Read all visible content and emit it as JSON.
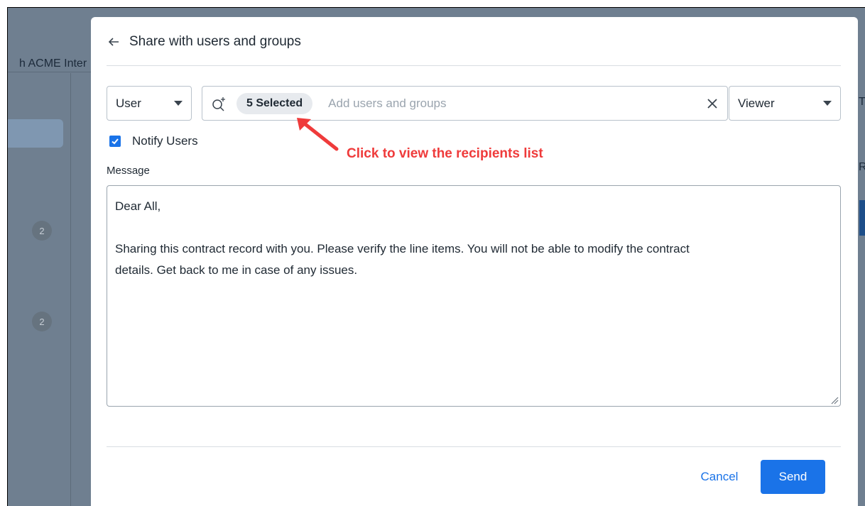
{
  "background": {
    "header_text": "h  ACME Inter",
    "badges": [
      "2",
      "2"
    ],
    "right_letters": [
      "T",
      "R"
    ]
  },
  "modal": {
    "back_icon": "arrow-left-icon",
    "title": "Share with users and groups",
    "type_select": {
      "value": "User"
    },
    "search": {
      "icon": "search-add-icon",
      "chip_label": "5 Selected",
      "placeholder": "Add users and groups",
      "clear_icon": "close-icon"
    },
    "role_select": {
      "value": "Viewer"
    },
    "notify": {
      "label": "Notify Users",
      "checked": true
    },
    "annotation": "Click to view the recipients list",
    "message": {
      "label": "Message",
      "lines": [
        "Dear All,",
        "",
        "Sharing this contract record with you. Please verify the line items. You will not be able to modify the contract",
        "details. Get back to me in case of any issues."
      ]
    },
    "footer": {
      "cancel_label": "Cancel",
      "send_label": "Send"
    }
  },
  "colors": {
    "accent": "#1a73e8",
    "annotation": "#ef3b3b",
    "overlay": "#6f7f90"
  }
}
